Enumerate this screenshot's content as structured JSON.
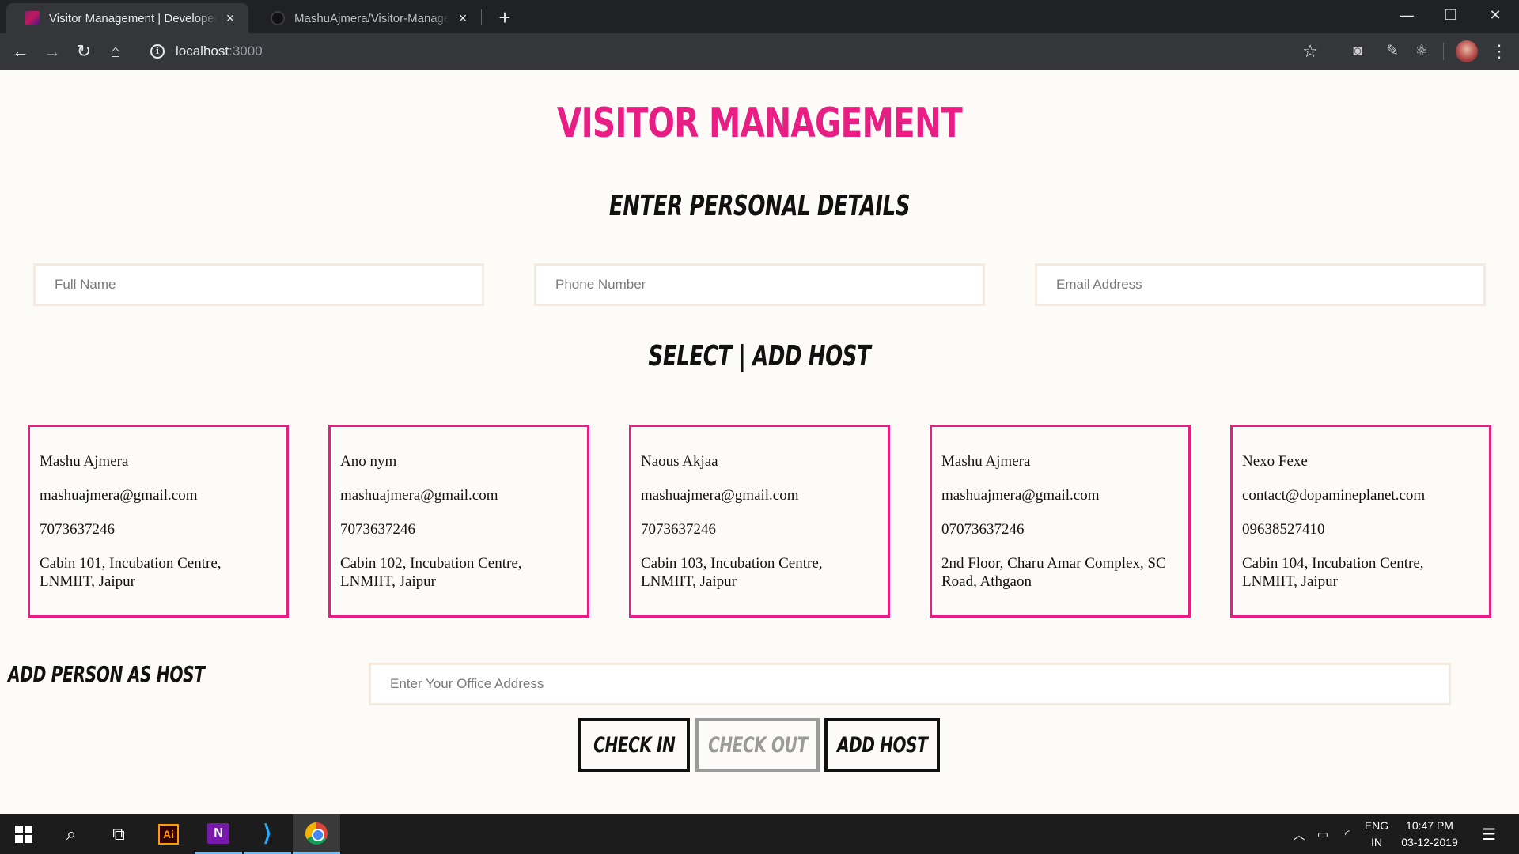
{
  "browser": {
    "tabs": [
      {
        "title": "Visitor Management | Developed",
        "active": true
      },
      {
        "title": "MashuAjmera/Visitor-Manageme",
        "active": false
      }
    ],
    "url_host": "localhost",
    "url_port": ":3000"
  },
  "page": {
    "title": "VISITOR MANAGEMENT",
    "personal_heading": "ENTER PERSONAL DETAILS",
    "inputs": {
      "full_name_placeholder": "Full Name",
      "phone_placeholder": "Phone Number",
      "email_placeholder": "Email Address"
    },
    "host_heading": "SELECT | ADD HOST",
    "hosts": [
      {
        "name": "Mashu Ajmera",
        "email": "mashuajmera@gmail.com",
        "phone": "7073637246",
        "address": "Cabin 101, Incubation Centre, LNMIIT, Jaipur"
      },
      {
        "name": "Ano nym",
        "email": "mashuajmera@gmail.com",
        "phone": "7073637246",
        "address": "Cabin 102, Incubation Centre, LNMIIT, Jaipur"
      },
      {
        "name": "Naous Akjaa",
        "email": "mashuajmera@gmail.com",
        "phone": "7073637246",
        "address": "Cabin 103, Incubation Centre, LNMIIT, Jaipur"
      },
      {
        "name": "Mashu Ajmera",
        "email": "mashuajmera@gmail.com",
        "phone": "07073637246",
        "address": "2nd Floor, Charu Amar Complex, SC Road, Athgaon"
      },
      {
        "name": "Nexo Fexe",
        "email": "contact@dopamineplanet.com",
        "phone": "09638527410",
        "address": "Cabin 104, Incubation Centre, LNMIIT, Jaipur"
      }
    ],
    "add_host_label": "ADD PERSON AS HOST",
    "office_address_placeholder": "Enter Your Office Address",
    "buttons": {
      "check_in": "CHECK IN",
      "check_out": "CHECK OUT",
      "add_host": "ADD HOST"
    },
    "accent_color": "#e91e84"
  },
  "taskbar": {
    "apps": [
      "windows-start",
      "search",
      "task-view",
      "illustrator",
      "onenote",
      "vscode",
      "chrome"
    ],
    "language_line1": "ENG",
    "language_line2": "IN",
    "time": "10:47 PM",
    "date": "03-12-2019"
  }
}
